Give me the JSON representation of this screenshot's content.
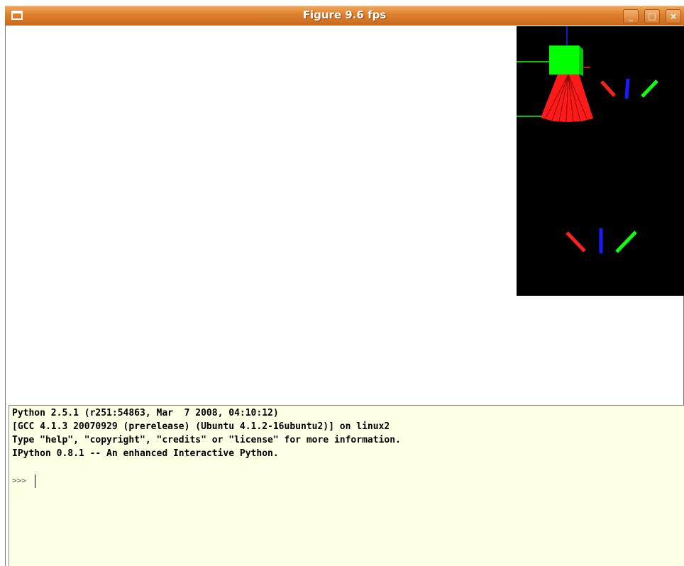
{
  "window": {
    "title": "Figure 9.6 fps",
    "minimize_glyph": "_",
    "maximize_glyph": "□",
    "close_glyph": "×"
  },
  "console": {
    "lines": [
      "Python 2.5.1 (r251:54863, Mar  7 2008, 04:10:12)",
      "[GCC 4.1.3 20070929 (prerelease) (Ubuntu 4.1.2-16ubuntu2)] on linux2",
      "Type \"help\", \"copyright\", \"credits\" or \"license\" for more information.",
      "IPython 0.8.1 -- An enhanced Interactive Python."
    ],
    "prompt": ">>>"
  },
  "colors": {
    "titlebar": "#dd7f2c",
    "console_bg": "#ffffe5",
    "scene_bg": "#000000",
    "cube": "#00ff00",
    "cone": "#ff2020",
    "axis_x": "#ff2020",
    "axis_y": "#1010ff",
    "axis_z": "#10ff10"
  }
}
